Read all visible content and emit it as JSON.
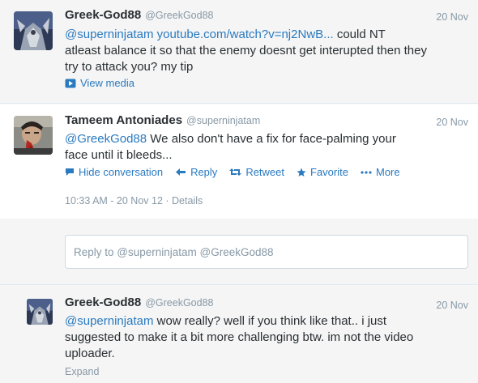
{
  "tweets": [
    {
      "fullname": "Greek-God88",
      "screenname": "@GreekGod88",
      "time": "20 Nov",
      "mention": "@superninjatam",
      "link": "youtube.com/watch?v=nj2NwB...",
      "line1_rest": " could NT",
      "line2": "atleast balance it so that the enemy doesnt get interupted then they",
      "line3": "try to attack you? my tip",
      "media_label": "View media"
    },
    {
      "fullname": "Tameem Antoniades",
      "screenname": "@superninjatam",
      "time": "20 Nov",
      "mention": "@GreekGod88",
      "line1_rest": " We also don't have a fix for face-palming your",
      "line2": "face until it bleeds...",
      "actions": {
        "hide": "Hide conversation",
        "reply": "Reply",
        "retweet": "Retweet",
        "favorite": "Favorite",
        "more": "More"
      },
      "timestamp": "10:33 AM - 20 Nov 12",
      "details": "Details"
    },
    {
      "fullname": "Greek-God88",
      "screenname": "@GreekGod88",
      "time": "20 Nov",
      "mention": "@superninjatam",
      "line1_rest": " wow really? well if you think like that.. i just",
      "line2": "suggested to make it a bit more challenging btw. im not the video",
      "line3": "uploader.",
      "expand": "Expand"
    }
  ],
  "reply_box": {
    "placeholder": "Reply to @superninjatam @GreekGod88"
  },
  "colors": {
    "link": "#2a7ac0",
    "muted": "#8899a6",
    "text": "#292f33"
  }
}
